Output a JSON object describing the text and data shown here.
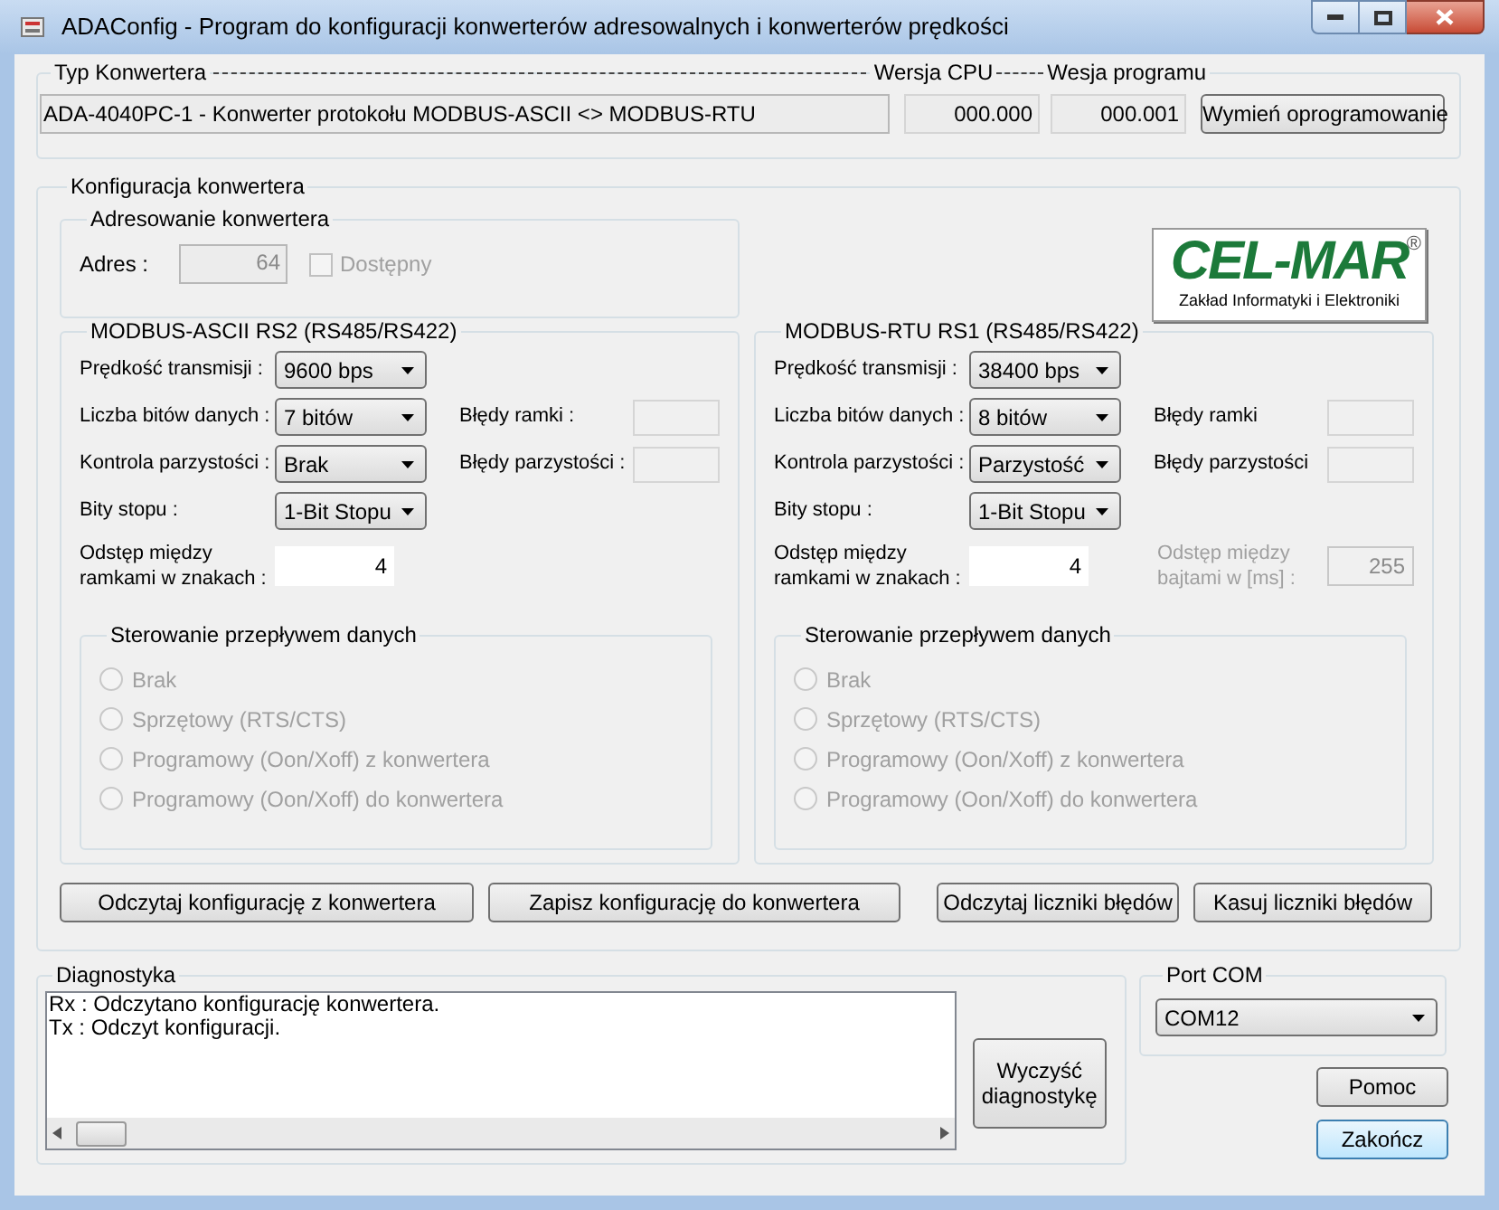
{
  "window": {
    "title": "ADAConfig - Program do konfiguracji konwerterów adresowalnych i konwerterów prędkości"
  },
  "converter": {
    "type_label": "Typ Konwertera",
    "cpu_label": "Wersja CPU",
    "program_label": "Wesja programu",
    "type_value": "ADA-4040PC-1 - Konwerter protokołu MODBUS-ASCII <> MODBUS-RTU",
    "cpu_version": "000.000",
    "program_version": "000.001",
    "update_button": "Wymień oprogramowanie"
  },
  "config": {
    "title": "Konfiguracja konwertera",
    "addressing": {
      "title": "Adresowanie konwertera",
      "address_label": "Adres :",
      "address_value": "64",
      "available": {
        "label": "Dostępny",
        "checked": false,
        "disabled": true
      }
    },
    "logo": {
      "name": "CEL-MAR",
      "mark": "®",
      "subtitle": "Zakład Informatyki i Elektroniki"
    },
    "ports": [
      {
        "title": "MODBUS-ASCII RS2 (RS485/RS422)",
        "settings": [
          {
            "label": "Prędkość transmisji :",
            "value": "9600 bps"
          },
          {
            "label": "Liczba bitów danych :",
            "value": "7 bitów"
          },
          {
            "label": "Kontrola parzystości :",
            "value": "Brak"
          },
          {
            "label": "Bity stopu :",
            "value": "1-Bit Stopu"
          }
        ],
        "errors": [
          {
            "label": "Błędy ramki :"
          },
          {
            "label": "Błędy parzystości :"
          }
        ],
        "gap": {
          "label": "Odstęp między ramkami w znakach :",
          "value": "4"
        },
        "flow": {
          "title": "Sterowanie przepływem danych",
          "options": [
            {
              "label": "Brak",
              "selected": false,
              "disabled": true
            },
            {
              "label": "Sprzętowy (RTS/CTS)",
              "selected": false,
              "disabled": true
            },
            {
              "label": "Programowy (Oon/Xoff) z konwertera",
              "selected": false,
              "disabled": true
            },
            {
              "label": "Programowy (Oon/Xoff) do konwertera",
              "selected": false,
              "disabled": true
            }
          ]
        }
      },
      {
        "title": "MODBUS-RTU RS1 (RS485/RS422)",
        "settings": [
          {
            "label": "Prędkość transmisji :",
            "value": "38400 bps"
          },
          {
            "label": "Liczba bitów danych :",
            "value": "8 bitów"
          },
          {
            "label": "Kontrola parzystości :",
            "value": "Parzystość"
          },
          {
            "label": "Bity stopu :",
            "value": "1-Bit Stopu"
          }
        ],
        "errors": [
          {
            "label": "Błędy ramki"
          },
          {
            "label": "Błędy parzystości"
          }
        ],
        "gap": {
          "label": "Odstęp między ramkami w znakach :",
          "value": "4"
        },
        "byte_gap": {
          "label": "Odstęp między bajtami w [ms] :",
          "value": "255",
          "disabled": true
        },
        "flow": {
          "title": "Sterowanie przepływem danych",
          "options": [
            {
              "label": "Brak",
              "selected": false,
              "disabled": true
            },
            {
              "label": "Sprzętowy (RTS/CTS)",
              "selected": false,
              "disabled": true
            },
            {
              "label": "Programowy (Oon/Xoff) z konwertera",
              "selected": false,
              "disabled": true
            },
            {
              "label": "Programowy (Oon/Xoff) do konwertera",
              "selected": false,
              "disabled": true
            }
          ]
        }
      }
    ],
    "buttons": [
      "Odczytaj konfigurację z konwertera",
      "Zapisz konfigurację do konwertera",
      "Odczytaj liczniki błędów",
      "Kasuj liczniki błędów"
    ]
  },
  "diagnostics": {
    "title": "Diagnostyka",
    "lines": [
      "Rx : Odczytano konfigurację konwertera.",
      "Tx : Odczyt konfiguracji."
    ],
    "clear_button": "Wyczyść diagnostykę"
  },
  "port_com": {
    "title": "Port COM",
    "value": "COM12"
  },
  "actions": [
    {
      "label": "Pomoc",
      "default": false
    },
    {
      "label": "Zakończ",
      "default": true
    }
  ]
}
